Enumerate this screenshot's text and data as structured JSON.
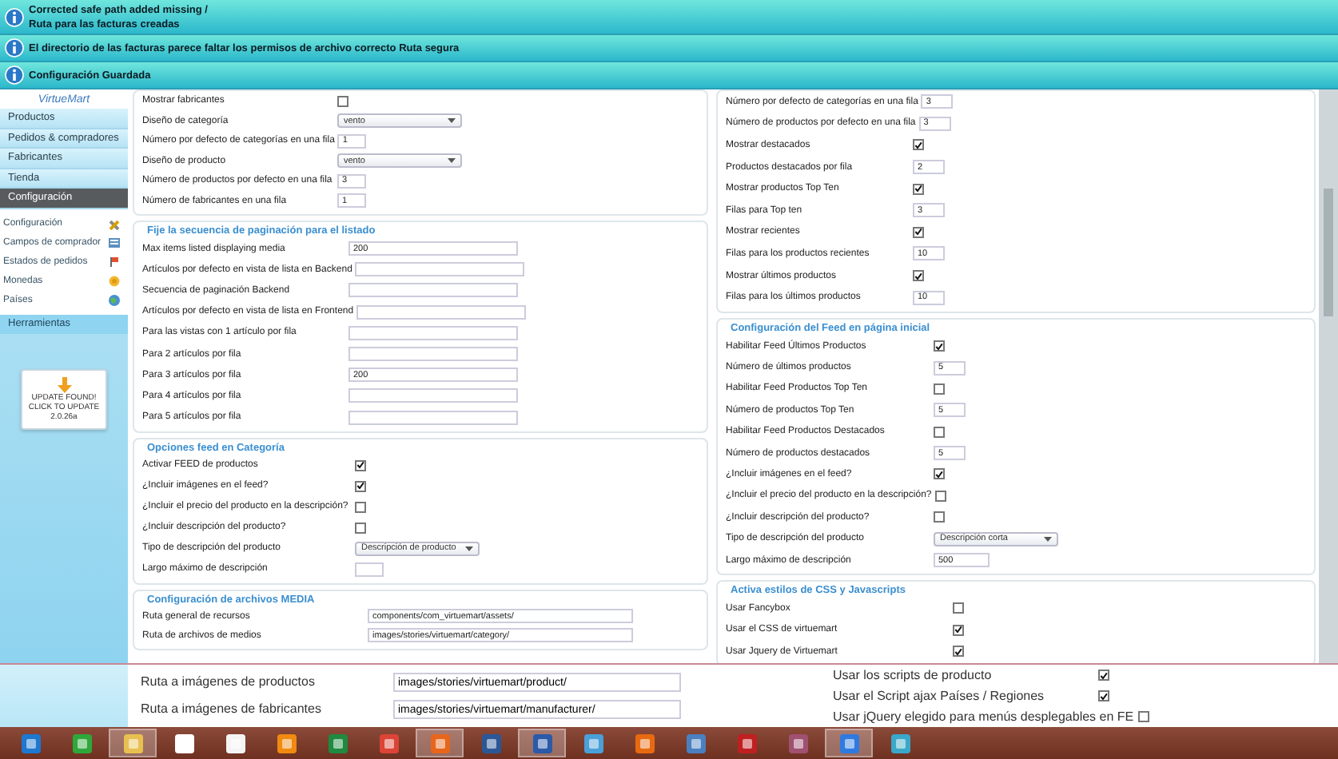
{
  "notifications": [
    {
      "lines": [
        "Corrected safe path added missing /",
        "Ruta para las facturas creadas"
      ]
    },
    {
      "lines": [
        "El directorio de las facturas parece faltar los permisos de archivo correcto Ruta segura"
      ]
    },
    {
      "lines": [
        "Configuración Guardada"
      ]
    }
  ],
  "sidebar": {
    "logo": "VirtueMart",
    "menu": [
      {
        "label": "Productos",
        "selected": false
      },
      {
        "label": "Pedidos & compradores",
        "selected": false
      },
      {
        "label": "Fabricantes",
        "selected": false
      },
      {
        "label": "Tienda",
        "selected": false
      },
      {
        "label": "Configuración",
        "selected": true
      }
    ],
    "submenu": [
      "Configuración",
      "Campos de comprador",
      "Estados de pedidos",
      "Monedas",
      "Países"
    ],
    "tools": "Herramientas",
    "update": [
      "UPDATE FOUND!",
      "CLICK TO UPDATE",
      "2.0.26a"
    ]
  },
  "left_column": [
    {
      "rows": [
        {
          "kind": "checkbox",
          "label": "Mostrar fabricantes",
          "checked": false
        },
        {
          "kind": "select",
          "label": "Diseño de categoría",
          "value": "vento"
        },
        {
          "kind": "text",
          "label": "Número por defecto de categorías en una fila",
          "value": "1"
        },
        {
          "kind": "select",
          "label": "Diseño de producto",
          "value": "vento"
        },
        {
          "kind": "text",
          "label": "Número de productos por defecto en una fila",
          "value": "3"
        },
        {
          "kind": "text",
          "label": "Número de fabricantes en una fila",
          "value": "1"
        }
      ]
    },
    {
      "title": "Fije la secuencia de paginación para el listado",
      "rows": [
        {
          "kind": "wide",
          "label": "Max items listed displaying media",
          "value": "200"
        },
        {
          "kind": "wide",
          "label": "Artículos por defecto en vista de lista en Backend"
        },
        {
          "kind": "wide",
          "label": "Secuencia de paginación Backend"
        },
        {
          "kind": "wide",
          "label": "Artículos por defecto en vista de lista en Frontend"
        },
        {
          "kind": "wide",
          "label": "Para las vistas con 1 artículo por fila"
        },
        {
          "kind": "wide",
          "label": "Para 2 artículos por fila"
        },
        {
          "kind": "wide",
          "label": "Para 3 artículos por fila",
          "value": "200"
        },
        {
          "kind": "wide",
          "label": "Para 4 artículos por fila"
        },
        {
          "kind": "wide",
          "label": "Para 5 artículos por fila"
        }
      ]
    },
    {
      "title": "Opciones feed en Categoría",
      "rows": [
        {
          "kind": "checkbox",
          "label": "Activar FEED de productos",
          "checked": true
        },
        {
          "kind": "checkbox",
          "label": "¿Incluir imágenes en el feed?",
          "checked": true
        },
        {
          "kind": "checkbox",
          "label": "¿Incluir el precio del producto en la descripción?",
          "checked": false
        },
        {
          "kind": "checkbox",
          "label": "¿Incluir descripción del producto?",
          "checked": false
        },
        {
          "kind": "select",
          "label": "Tipo de descripción del producto",
          "value": "Descripción de producto"
        },
        {
          "kind": "text",
          "label": "Largo máximo de descripción"
        }
      ]
    },
    {
      "title": "Configuración de archivos MEDIA",
      "rows": [
        {
          "kind": "path",
          "label": "Ruta general de recursos",
          "value": "components/com_virtuemart/assets/"
        },
        {
          "kind": "path",
          "label": "Ruta de archivos de medios",
          "value": "images/stories/virtuemart/category/"
        }
      ]
    }
  ],
  "right_column": [
    {
      "rows": [
        {
          "kind": "text",
          "label": "Número por defecto de categorías en una fila",
          "value": "3"
        },
        {
          "kind": "text",
          "label": "Número de productos por defecto en una fila",
          "value": "3"
        },
        {
          "kind": "checkbox",
          "label": "Mostrar destacados",
          "checked": true
        },
        {
          "kind": "text",
          "label": "Productos destacados por fila",
          "value": "2"
        },
        {
          "kind": "checkbox",
          "label": "Mostrar productos Top Ten",
          "checked": true
        },
        {
          "kind": "text",
          "label": "Filas para Top ten",
          "value": "3"
        },
        {
          "kind": "checkbox",
          "label": "Mostrar recientes",
          "checked": true
        },
        {
          "kind": "text",
          "label": "Filas para los productos recientes",
          "value": "10"
        },
        {
          "kind": "checkbox",
          "label": "Mostrar últimos productos",
          "checked": true
        },
        {
          "kind": "text",
          "label": "Filas para los últimos productos",
          "value": "10"
        }
      ]
    },
    {
      "title": "Configuración del Feed en página inicial",
      "rows": [
        {
          "kind": "checkbox",
          "label": "Habilitar Feed Últimos Productos",
          "checked": true
        },
        {
          "kind": "text",
          "label": "Número de últimos productos",
          "value": "5"
        },
        {
          "kind": "checkbox",
          "label": "Habilitar Feed Productos Top Ten",
          "checked": false
        },
        {
          "kind": "text",
          "label": "Número de productos Top Ten",
          "value": "5"
        },
        {
          "kind": "checkbox",
          "label": "Habilitar Feed Productos Destacados",
          "checked": false
        },
        {
          "kind": "text",
          "label": "Número de productos destacados",
          "value": "5"
        },
        {
          "kind": "checkbox",
          "label": "¿Incluir imágenes en el feed?",
          "checked": true
        },
        {
          "kind": "checkbox",
          "label": "¿Incluir el precio del producto en la descripción?",
          "checked": false
        },
        {
          "kind": "checkbox",
          "label": "¿Incluir descripción del producto?",
          "checked": false
        },
        {
          "kind": "select",
          "label": "Tipo de descripción del producto",
          "value": "Descripción corta"
        },
        {
          "kind": "text",
          "label": "Largo máximo de descripción",
          "value": "500"
        }
      ]
    },
    {
      "title": "Activa estilos de CSS y Javascripts",
      "rows": [
        {
          "kind": "checkbox",
          "label": "Usar Fancybox",
          "checked": false
        },
        {
          "kind": "checkbox",
          "label": "Usar el CSS de virtuemart",
          "checked": true
        },
        {
          "kind": "checkbox",
          "label": "Usar Jquery de Virtuemart",
          "checked": true
        }
      ]
    }
  ],
  "zoomed_strip": {
    "left_rows": [
      {
        "label": "Ruta a imágenes de productos",
        "value": "images/stories/virtuemart/product/"
      },
      {
        "label": "Ruta a imágenes de fabricantes",
        "value": "images/stories/virtuemart/manufacturer/"
      }
    ],
    "right_rows": [
      {
        "label": "Usar los scripts de producto",
        "checked": true
      },
      {
        "label": "Usar el Script ajax Países / Regiones",
        "checked": true
      },
      {
        "label": "Usar jQuery elegido para menús desplegables en FE",
        "checked": false
      }
    ]
  },
  "taskbar": [
    {
      "active": false
    },
    {
      "active": false
    },
    {
      "active": true
    },
    {
      "active": false
    },
    {
      "active": false
    },
    {
      "active": false
    },
    {
      "active": false
    },
    {
      "active": false
    },
    {
      "active": true
    },
    {
      "active": false
    },
    {
      "active": true
    },
    {
      "active": false
    },
    {
      "active": false
    },
    {
      "active": false
    },
    {
      "active": false
    },
    {
      "active": false
    },
    {
      "active": true
    },
    {
      "active": false
    }
  ]
}
